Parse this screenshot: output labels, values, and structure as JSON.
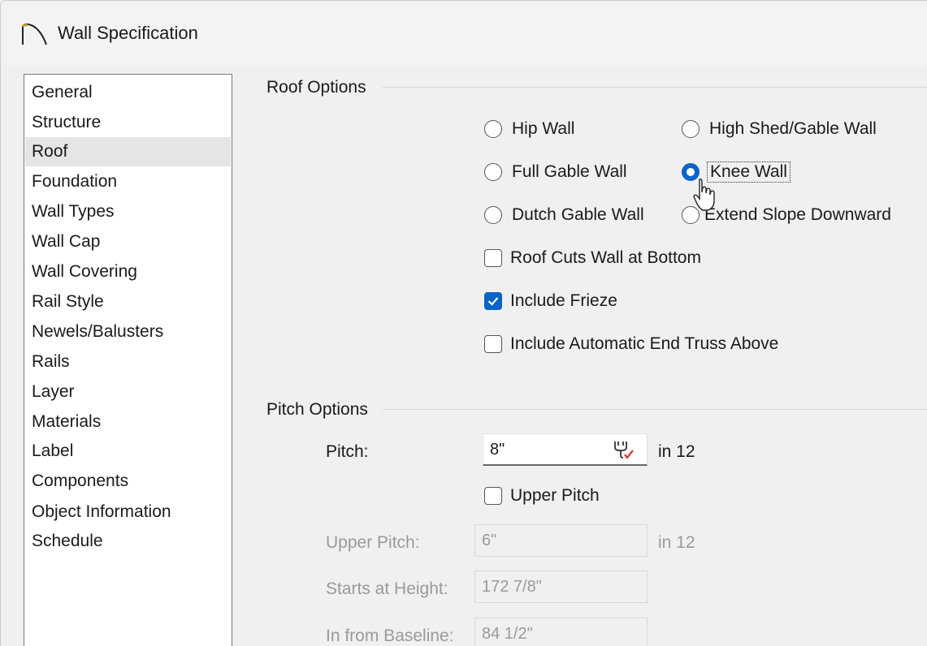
{
  "window": {
    "title": "Wall Specification"
  },
  "sidebar": {
    "items": [
      {
        "label": "General"
      },
      {
        "label": "Structure"
      },
      {
        "label": "Roof"
      },
      {
        "label": "Foundation"
      },
      {
        "label": "Wall Types"
      },
      {
        "label": "Wall Cap"
      },
      {
        "label": "Wall Covering"
      },
      {
        "label": "Rail Style"
      },
      {
        "label": "Newels/Balusters"
      },
      {
        "label": "Rails"
      },
      {
        "label": "Layer"
      },
      {
        "label": "Materials"
      },
      {
        "label": "Label"
      },
      {
        "label": "Components"
      },
      {
        "label": "Object Information"
      },
      {
        "label": "Schedule"
      }
    ],
    "selected": "Roof"
  },
  "roof_options": {
    "title": "Roof Options",
    "radios": {
      "hip_wall": "Hip Wall",
      "high_shed_gable_wall": "High Shed/Gable Wall",
      "full_gable_wall": "Full Gable Wall",
      "knee_wall": "Knee Wall",
      "dutch_gable_wall": "Dutch Gable Wall",
      "extend_slope_downward": "Extend Slope Downward"
    },
    "selected_radio": "Knee Wall",
    "checkboxes": {
      "roof_cuts_wall": {
        "label": "Roof Cuts Wall at Bottom",
        "checked": false
      },
      "include_frieze": {
        "label": "Include Frieze",
        "checked": true
      },
      "include_end_truss": {
        "label": "Include Automatic End Truss Above",
        "checked": false
      }
    }
  },
  "pitch_options": {
    "title": "Pitch Options",
    "pitch": {
      "label": "Pitch:",
      "value": "8\"",
      "unit": "in 12"
    },
    "upper_pitch_checkbox": {
      "label": "Upper Pitch",
      "checked": false
    },
    "upper_pitch": {
      "label": "Upper Pitch:",
      "value": "6\"",
      "unit": "in 12"
    },
    "starts_at_height": {
      "label": "Starts at Height:",
      "value": "172 7/8\""
    },
    "in_from_baseline": {
      "label": "In from Baseline:",
      "value": "84 1/2\""
    }
  },
  "colors": {
    "accent": "#0a64c8",
    "disabled_text": "#9a9a9a"
  }
}
